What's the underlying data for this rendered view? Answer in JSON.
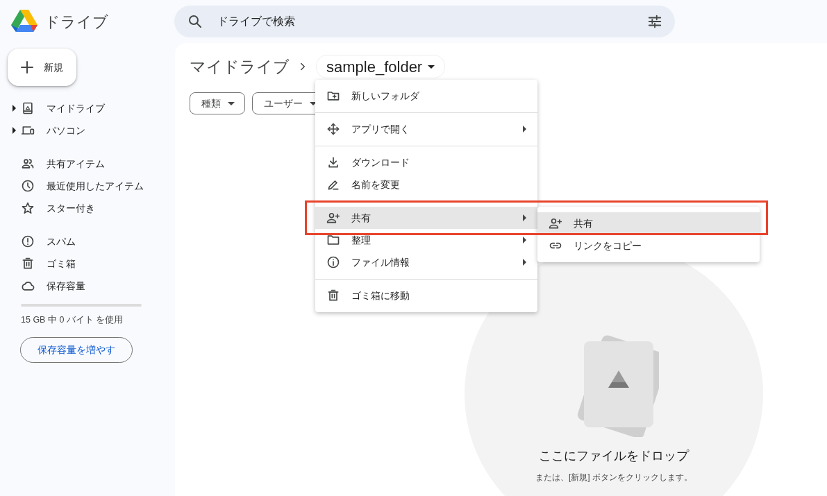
{
  "app": {
    "title": "ドライブ"
  },
  "search": {
    "placeholder": "ドライブで検索"
  },
  "new_button": {
    "label": "新規"
  },
  "sidebar": {
    "groups": [
      [
        {
          "label": "マイドライブ",
          "expanded": false
        },
        {
          "label": "パソコン",
          "expanded": false
        }
      ],
      [
        {
          "label": "共有アイテム"
        },
        {
          "label": "最近使用したアイテム"
        },
        {
          "label": "スター付き"
        }
      ],
      [
        {
          "label": "スパム"
        },
        {
          "label": "ゴミ箱"
        },
        {
          "label": "保存容量"
        }
      ]
    ]
  },
  "storage": {
    "level": 0,
    "usage": "15 GB 中 0 バイト を使用",
    "button": "保存容量を増やす"
  },
  "breadcrumb": {
    "root": "マイドライブ",
    "current": "sample_folder"
  },
  "filters": [
    {
      "label": "種類"
    },
    {
      "label": "ユーザー"
    }
  ],
  "context_menu": {
    "sections": [
      [
        {
          "label": "新しいフォルダ",
          "submenu": false,
          "selected": false
        }
      ],
      [
        {
          "label": "アプリで開く",
          "submenu": true,
          "selected": false
        }
      ],
      [
        {
          "label": "ダウンロード",
          "submenu": false,
          "selected": false
        },
        {
          "label": "名前を変更",
          "submenu": false,
          "selected": false
        }
      ],
      [
        {
          "label": "共有",
          "submenu": true,
          "selected": true
        },
        {
          "label": "整理",
          "submenu": true,
          "selected": false
        },
        {
          "label": "ファイル情報",
          "submenu": true,
          "selected": false
        }
      ],
      [
        {
          "label": "ゴミ箱に移動",
          "submenu": false,
          "selected": false
        }
      ]
    ]
  },
  "submenu": {
    "items": [
      {
        "label": "共有",
        "selected": true
      },
      {
        "label": "リンクをコピー",
        "selected": false
      }
    ]
  },
  "empty_state": {
    "title": "ここにファイルをドロップ",
    "subtitle": "または、[新規] ボタンをクリックします。"
  }
}
